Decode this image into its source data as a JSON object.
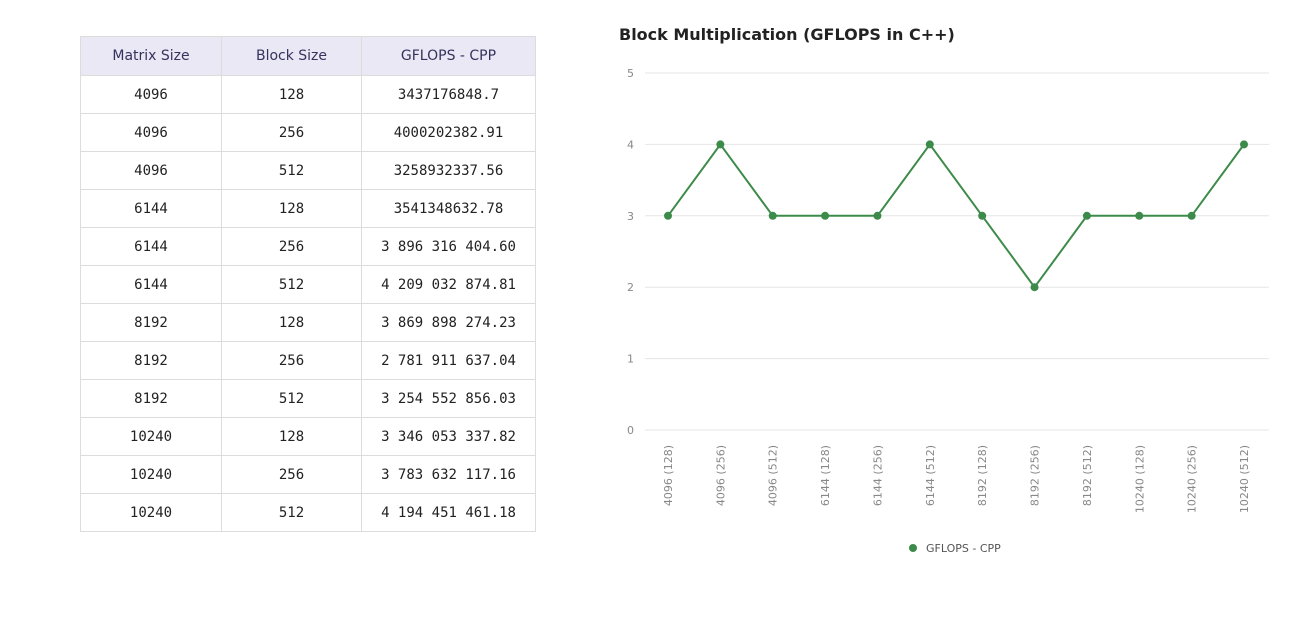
{
  "table": {
    "headers": [
      "Matrix Size",
      "Block Size",
      "GFLOPS - CPP"
    ],
    "rows": [
      [
        "4096",
        "128",
        "3437176848.7"
      ],
      [
        "4096",
        "256",
        "4000202382.91"
      ],
      [
        "4096",
        "512",
        "3258932337.56"
      ],
      [
        "6144",
        "128",
        "3541348632.78"
      ],
      [
        "6144",
        "256",
        "3 896 316 404.60"
      ],
      [
        "6144",
        "512",
        "4 209 032 874.81"
      ],
      [
        "8192",
        "128",
        "3 869 898 274.23"
      ],
      [
        "8192",
        "256",
        "2 781 911 637.04"
      ],
      [
        "8192",
        "512",
        "3 254 552 856.03"
      ],
      [
        "10240",
        "128",
        "3 346 053 337.82"
      ],
      [
        "10240",
        "256",
        "3 783 632 117.16"
      ],
      [
        "10240",
        "512",
        "4 194 451 461.18"
      ]
    ]
  },
  "chart_data": {
    "type": "line",
    "title": "Block Multiplication (GFLOPS in C++)",
    "categories": [
      "4096 (128)",
      "4096 (256)",
      "4096 (512)",
      "6144 (128)",
      "6144 (256)",
      "6144 (512)",
      "8192 (128)",
      "8192 (256)",
      "8192 (512)",
      "10240 (128)",
      "10240 (256)",
      "10240 (512)"
    ],
    "series": [
      {
        "name": "GFLOPS - CPP",
        "values": [
          3,
          4,
          3,
          3,
          3,
          4,
          3,
          2,
          3,
          3,
          3,
          4
        ],
        "color": "#3d8b4a"
      }
    ],
    "ylim": [
      0,
      5
    ],
    "yticks": [
      "0",
      "1",
      "2",
      "3",
      "4",
      "5"
    ],
    "grid": true,
    "legend_position": "bottom-center"
  }
}
